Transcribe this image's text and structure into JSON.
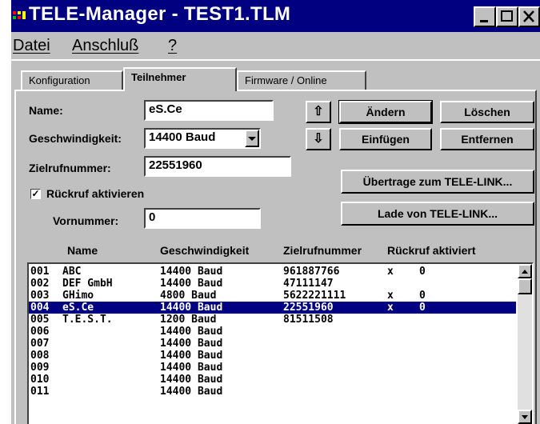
{
  "window": {
    "title": "TELE-Manager - TEST1.TLM"
  },
  "menu": {
    "items": [
      "Datei",
      "Anschluß",
      "?"
    ]
  },
  "tabs": [
    "Konfiguration",
    "Teilnehmer",
    "Firmware / Online"
  ],
  "form": {
    "name_label": "Name:",
    "name_value": "eS.Ce",
    "speed_label": "Geschwindigkeit:",
    "speed_value": "14400 Baud",
    "number_label": "Zielrufnummer:",
    "number_value": "22551960",
    "callback_label": "Rückruf aktivieren",
    "callback_checked": true,
    "prefix_label": "Vornummer:",
    "prefix_value": "0"
  },
  "buttons": {
    "up": "⇧",
    "down": "⇩",
    "change": "Ändern",
    "delete": "Löschen",
    "insert": "Einfügen",
    "remove": "Entfernen",
    "transfer": "Übertrage zum TELE-LINK...",
    "load": "Lade von TELE-LINK..."
  },
  "list": {
    "columns": [
      "Name",
      "Geschwindigkeit",
      "Zielrufnummer",
      "Rückruf aktiviert"
    ],
    "rows": [
      {
        "id": "001",
        "name": "ABC",
        "speed": "14400 Baud",
        "number": "961887766",
        "cb": "x",
        "prefix": "0",
        "selected": false
      },
      {
        "id": "002",
        "name": "DEF GmbH",
        "speed": "14400 Baud",
        "number": "47111147",
        "cb": "",
        "prefix": "",
        "selected": false
      },
      {
        "id": "003",
        "name": "GHimo",
        "speed": "4800 Baud",
        "number": "5622221111",
        "cb": "x",
        "prefix": "0",
        "selected": false
      },
      {
        "id": "004",
        "name": "eS.Ce",
        "speed": "14400 Baud",
        "number": "22551960",
        "cb": "x",
        "prefix": "0",
        "selected": true
      },
      {
        "id": "005",
        "name": "T.E.S.T.",
        "speed": "1200 Baud",
        "number": "81511508",
        "cb": "",
        "prefix": "",
        "selected": false
      },
      {
        "id": "006",
        "name": "",
        "speed": "14400 Baud",
        "number": "",
        "cb": "",
        "prefix": "",
        "selected": false
      },
      {
        "id": "007",
        "name": "",
        "speed": "14400 Baud",
        "number": "",
        "cb": "",
        "prefix": "",
        "selected": false
      },
      {
        "id": "008",
        "name": "",
        "speed": "14400 Baud",
        "number": "",
        "cb": "",
        "prefix": "",
        "selected": false
      },
      {
        "id": "009",
        "name": "",
        "speed": "14400 Baud",
        "number": "",
        "cb": "",
        "prefix": "",
        "selected": false
      },
      {
        "id": "010",
        "name": "",
        "speed": "14400 Baud",
        "number": "",
        "cb": "",
        "prefix": "",
        "selected": false
      },
      {
        "id": "011",
        "name": "",
        "speed": "14400 Baud",
        "number": "",
        "cb": "",
        "prefix": "",
        "selected": false
      }
    ]
  },
  "colors": {
    "titlebar": "#000080",
    "selection": "#000080",
    "face": "#c0c0c0"
  }
}
